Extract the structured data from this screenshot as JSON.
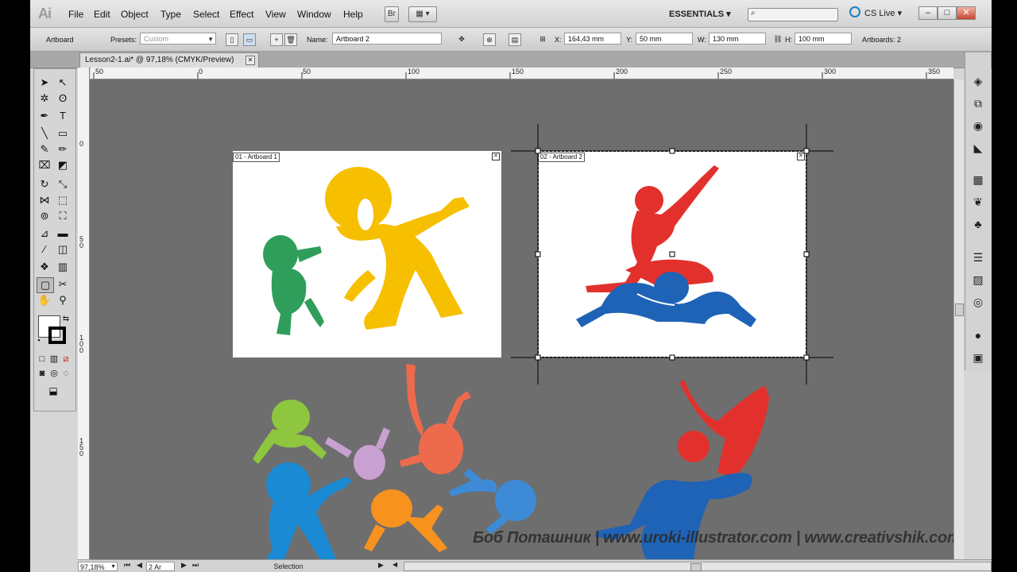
{
  "app": {
    "logo": "Ai"
  },
  "menu": [
    "File",
    "Edit",
    "Object",
    "Type",
    "Select",
    "Effect",
    "View",
    "Window",
    "Help"
  ],
  "menubar_buttons": {
    "bridge": "Br",
    "arrange": "▦ ▾"
  },
  "workspace": {
    "label": "ESSENTIALS ▾",
    "search_placeholder": "",
    "cslive": "CS Live ▾"
  },
  "window_controls": {
    "min": "–",
    "max": "□",
    "close": "✕"
  },
  "control": {
    "artboard_label": "Artboard",
    "presets_label": "Presets:",
    "presets_value": "Custom",
    "name_label": "Name:",
    "name_value": "Artboard 2",
    "x_label": "X:",
    "x_value": "164,43 mm",
    "y_label": "Y:",
    "y_value": "50 mm",
    "w_label": "W:",
    "w_value": "130 mm",
    "h_label": "H:",
    "h_value": "100 mm",
    "artboards_count": "Artboards: 2"
  },
  "doc_tab": {
    "title": "Lesson2-1.ai* @ 97,18% (CMYK/Preview)",
    "close": "✕"
  },
  "ruler_top": [
    "50",
    "0",
    "50",
    "100",
    "150",
    "200",
    "250",
    "300",
    "350"
  ],
  "ruler_left": [
    "0",
    "5\n0",
    "1\n0\n0",
    "1\n5\n0"
  ],
  "artboards": [
    {
      "label": "01 - Artboard 1"
    },
    {
      "label": "02 - Artboard 2"
    }
  ],
  "watermark": "Боб Поташник | www.uroki-illustrator.com | www.creativshik.com",
  "status": {
    "zoom": "97,18%",
    "artboard_nav": "2 Ar",
    "tool": "Selection"
  },
  "colors": {
    "canvas": "#6e6e6e",
    "yellow": "#f6bf00",
    "green": "#2f9e5b",
    "red": "#e2312d",
    "blue": "#1f63b6",
    "lime": "#8ec63f",
    "lilac": "#c9a0d2",
    "salmon": "#ee6a4c",
    "orange": "#f7921e",
    "sky": "#3d8bd6",
    "cyan": "#1a8ad4"
  }
}
